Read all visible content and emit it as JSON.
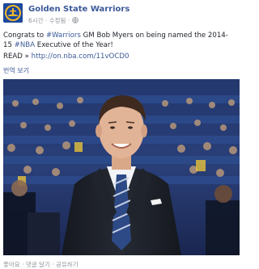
{
  "page": {
    "name": "Golden State Warriors",
    "time": "6시간",
    "dot": "·",
    "edited": "수정됨",
    "dot2": "·"
  },
  "post": {
    "prefix": "Congrats to ",
    "hashtag1": "#Warriors",
    "middle": " GM Bob Myers on being named the 2014-15 ",
    "hashtag2": "#NBA",
    "suffix": " Executive of the Year!",
    "read_label": "READ » ",
    "link": "http://on.nba.com/11vOCD0"
  },
  "translate_label": "번역 보기",
  "actions": {
    "like": "좋아요",
    "sep1": " · ",
    "comment": "댓글 달기",
    "sep2": " · ",
    "share": "공유하기"
  },
  "icons": {
    "avatar": "warriors-logo",
    "privacy": "globe-icon"
  },
  "colors": {
    "link": "#3b5998",
    "meta": "#90949c",
    "text": "#1d2129"
  }
}
